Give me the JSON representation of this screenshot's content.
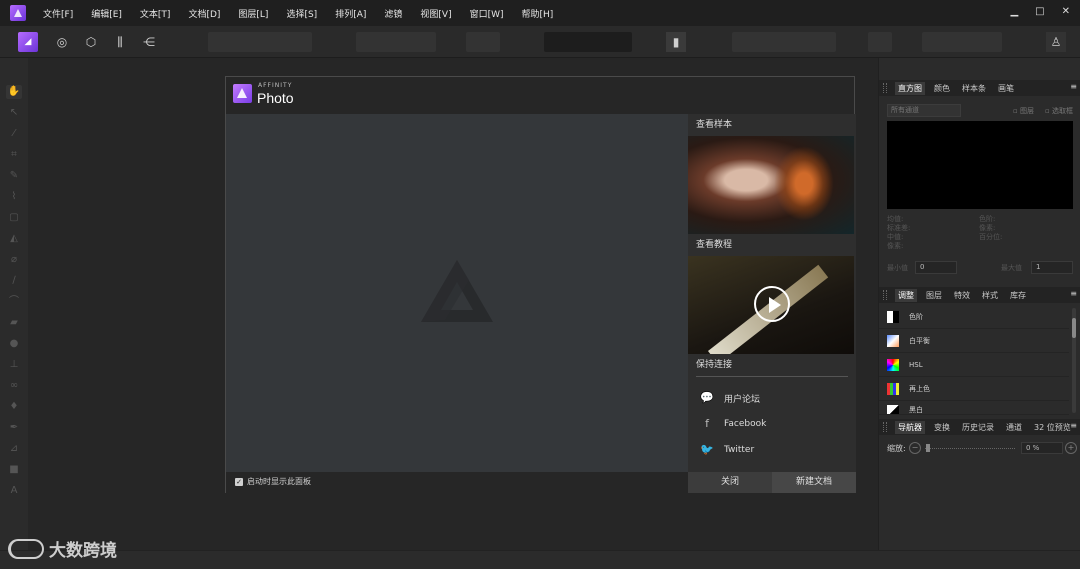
{
  "menubar": {
    "items": [
      "文件[F]",
      "编辑[E]",
      "文本[T]",
      "文档[D]",
      "图层[L]",
      "选择[S]",
      "排列[A]",
      "滤镜",
      "视图[V]",
      "窗口[W]",
      "帮助[H]"
    ],
    "window_controls": [
      "▁",
      "□",
      "✕"
    ]
  },
  "dialog": {
    "brand": "AFFINITY",
    "product": "Photo",
    "sidebar": {
      "samples_title": "查看样本",
      "tutorials_title": "查看教程",
      "connected_title": "保持连接",
      "links": [
        "用户论坛",
        "Facebook",
        "Twitter"
      ]
    },
    "footer": {
      "show_on_startup_label": "启动时显示此面板",
      "show_on_startup_checked": true,
      "close_label": "关闭",
      "new_document_label": "新建文档"
    }
  },
  "panels": {
    "histogram": {
      "tabs": [
        "直方图",
        "颜色",
        "样本条",
        "画笔"
      ],
      "channel_select": "所有通道",
      "layer_option": "图层",
      "marquee_option": "选取框",
      "stats_left": [
        "均值:",
        "标准差:",
        "中值:",
        "像素:"
      ],
      "stats_right": [
        "色阶:",
        "像素:",
        "百分位:"
      ],
      "min_label": "最小值",
      "min_value": "0",
      "max_label": "最大值",
      "max_value": "1"
    },
    "adjustments": {
      "tabs": [
        "调整",
        "图层",
        "特效",
        "样式",
        "库存"
      ],
      "items": [
        "色阶",
        "白平衡",
        "HSL",
        "再上色",
        "黑白"
      ]
    },
    "navigator": {
      "tabs": [
        "导航器",
        "变换",
        "历史记录",
        "通道",
        "32 位预览"
      ],
      "zoom_label": "缩放:",
      "zoom_value": "0 %"
    }
  },
  "watermark": "大数跨境",
  "colors": {
    "accent_purple": "#8f4be8",
    "dialog_bg": "#2e2e2e",
    "canvas_bg": "#34373a"
  }
}
